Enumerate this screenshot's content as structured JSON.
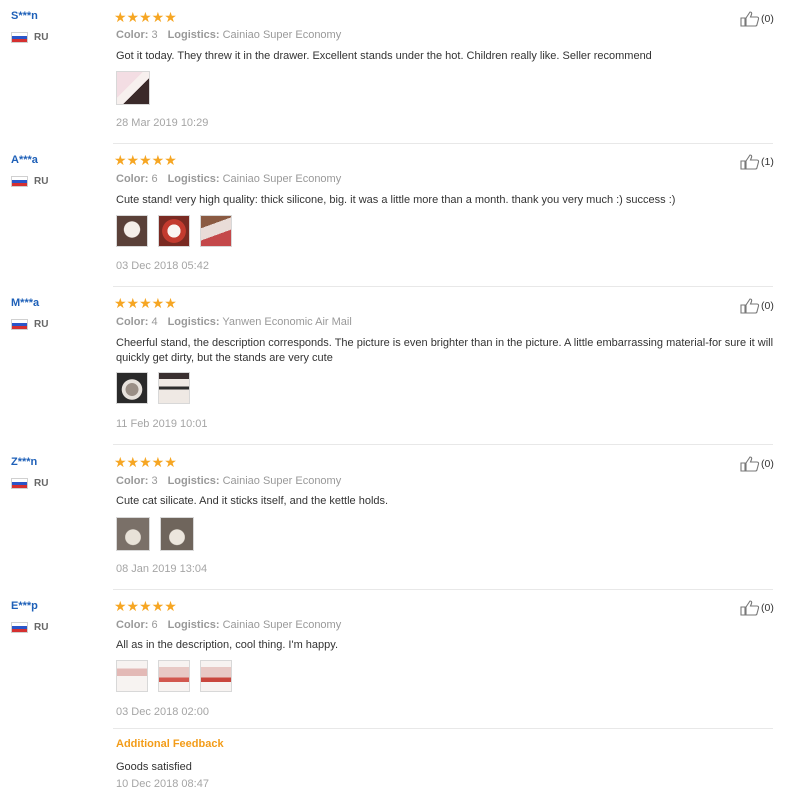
{
  "reviews": [
    {
      "user": "S***n",
      "country": "RU",
      "stars": "★★★★★",
      "likes": "(0)",
      "color_label": "Color:",
      "color_value": "3",
      "logistics_label": "Logistics:",
      "logistics_value": "Cainiao Super Economy",
      "text": "Got it today. They threw it in the drawer. Excellent stands under the hot. Children really like. Seller recommend",
      "photos": [
        "photo-1"
      ],
      "date": "28 Mar 2019 10:29"
    },
    {
      "user": "A***a",
      "country": "RU",
      "stars": "★★★★★",
      "likes": "(1)",
      "color_label": "Color:",
      "color_value": "6",
      "logistics_label": "Logistics:",
      "logistics_value": "Cainiao Super Economy",
      "text": "Cute stand! very high quality: thick silicone, big. it was a little more than a month. thank you very much :) success :)",
      "photos": [
        "photo-1",
        "photo-2",
        "photo-3"
      ],
      "date": "03 Dec 2018 05:42"
    },
    {
      "user": "M***a",
      "country": "RU",
      "stars": "★★★★★",
      "likes": "(0)",
      "color_label": "Color:",
      "color_value": "4",
      "logistics_label": "Logistics:",
      "logistics_value": "Yanwen Economic Air Mail",
      "text": "Cheerful stand, the description corresponds. The picture is even brighter than in the picture. A little embarrassing material-for sure it will quickly get dirty, but the stands are very cute",
      "photos": [
        "photo-1",
        "photo-2"
      ],
      "date": "11 Feb 2019 10:01"
    },
    {
      "user": "Z***n",
      "country": "RU",
      "stars": "★★★★★",
      "likes": "(0)",
      "color_label": "Color:",
      "color_value": "3",
      "logistics_label": "Logistics:",
      "logistics_value": "Cainiao Super Economy",
      "text": "Cute cat silicate. And it sticks itself, and the kettle holds.",
      "photos": [
        "photo-1",
        "photo-2"
      ],
      "date": "08 Jan 2019 13:04"
    },
    {
      "user": "E***p",
      "country": "RU",
      "stars": "★★★★★",
      "likes": "(0)",
      "color_label": "Color:",
      "color_value": "6",
      "logistics_label": "Logistics:",
      "logistics_value": "Cainiao Super Economy",
      "text": "All as in the description, cool thing. I'm happy.",
      "photos": [
        "photo-1",
        "photo-2",
        "photo-3"
      ],
      "date": "03 Dec 2018 02:00",
      "additional_feedback": {
        "title": "Additional Feedback",
        "text": "Goods satisfied",
        "date": "10 Dec 2018 08:47"
      }
    }
  ],
  "colors": {
    "user_link": "#1e60b8",
    "stars": "#f6a623",
    "additional": "#f39c18"
  },
  "icons": {
    "like": "thumbs-up-icon",
    "flag": "russia-flag-icon"
  }
}
